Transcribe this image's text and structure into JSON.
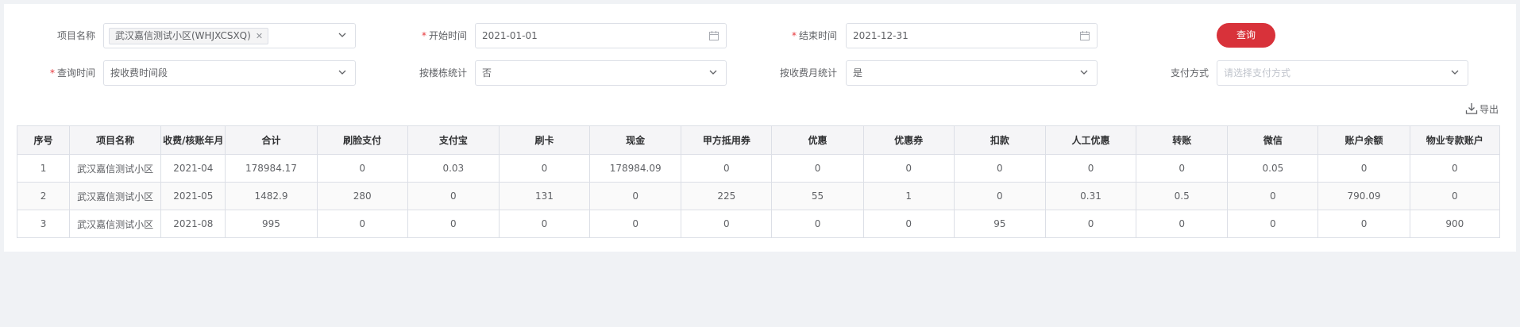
{
  "filters": {
    "project": {
      "label": "项目名称",
      "tag": "武汉嘉信测试小区(WHJXCSXQ)"
    },
    "start_time": {
      "label": "开始时间",
      "value": "2021-01-01"
    },
    "end_time": {
      "label": "结束时间",
      "value": "2021-12-31"
    },
    "query_time": {
      "label": "查询时间",
      "value": "按收费时间段"
    },
    "by_building": {
      "label": "按楼栋统计",
      "value": "否"
    },
    "by_month": {
      "label": "按收费月统计",
      "value": "是"
    },
    "payment_method": {
      "label": "支付方式",
      "placeholder": "请选择支付方式"
    }
  },
  "required_mark": "*",
  "query_button": "查询",
  "export_label": "导出",
  "table": {
    "headers": [
      "序号",
      "项目名称",
      "收费/核账年月",
      "合计",
      "刷脸支付",
      "支付宝",
      "刷卡",
      "现金",
      "甲方抵用券",
      "优惠",
      "优惠券",
      "扣款",
      "人工优惠",
      "转账",
      "微信",
      "账户余额",
      "物业专款账户"
    ],
    "rows": [
      [
        "1",
        "武汉嘉信测试小区",
        "2021-04",
        "178984.17",
        "0",
        "0.03",
        "0",
        "178984.09",
        "0",
        "0",
        "0",
        "0",
        "0",
        "0",
        "0.05",
        "0",
        "0"
      ],
      [
        "2",
        "武汉嘉信测试小区",
        "2021-05",
        "1482.9",
        "280",
        "0",
        "131",
        "0",
        "225",
        "55",
        "1",
        "0",
        "0.31",
        "0.5",
        "0",
        "790.09",
        "0"
      ],
      [
        "3",
        "武汉嘉信测试小区",
        "2021-08",
        "995",
        "0",
        "0",
        "0",
        "0",
        "0",
        "0",
        "0",
        "95",
        "0",
        "0",
        "0",
        "0",
        "900"
      ]
    ]
  },
  "colors": {
    "accent": "#d8323a",
    "required": "#e6353a",
    "border": "#dcdfe6",
    "header_bg": "#f5f5f7"
  }
}
